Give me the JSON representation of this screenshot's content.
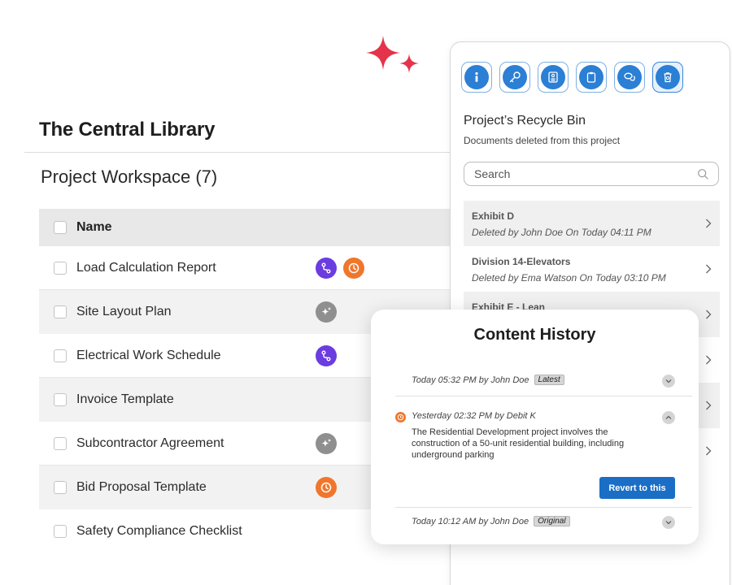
{
  "library": {
    "title": "The Central Library",
    "workspace_title": "Project Workspace (7)",
    "table": {
      "header_label": "Name",
      "rows": [
        {
          "name": "Load Calculation Report",
          "badges": [
            "workflow-icon",
            "history-icon"
          ]
        },
        {
          "name": "Site Layout Plan",
          "badges": [
            "ai-sparkle-icon"
          ]
        },
        {
          "name": "Electrical Work Schedule",
          "badges": [
            "workflow-icon"
          ]
        },
        {
          "name": "Invoice Template",
          "badges": []
        },
        {
          "name": "Subcontractor Agreement",
          "badges": [
            "ai-sparkle-icon"
          ]
        },
        {
          "name": "Bid Proposal Template",
          "badges": [
            "history-icon"
          ]
        },
        {
          "name": "Safety Compliance Checklist",
          "badges": []
        }
      ]
    }
  },
  "side_panel": {
    "toolbar_icons": [
      "info-icon",
      "key-icon",
      "contact-card-icon",
      "clipboard-icon",
      "chat-icon",
      "recycle-bin-icon"
    ],
    "active_icon": "recycle-bin-icon",
    "title": "Project’s Recycle Bin",
    "subtitle": "Documents deleted from this project",
    "search": {
      "placeholder": "Search"
    },
    "deleted_items": [
      {
        "name": "Exhibit D",
        "detail": "Deleted by John Doe On Today 04:11 PM"
      },
      {
        "name": "Division 14-Elevators",
        "detail": "Deleted by Ema Watson On Today 03:10 PM"
      },
      {
        "name": "Exhibit E - Lean",
        "detail": ""
      }
    ]
  },
  "content_history": {
    "title": "Content History",
    "entries": [
      {
        "meta": "Today 05:32 PM by John Doe",
        "tag": "Latest",
        "expanded": false
      },
      {
        "meta": "Yesterday 02:32 PM by Debit K",
        "tag": "",
        "expanded": true,
        "body": "The Residential Development project involves the construction of a 50-unit residential building, including underground parking",
        "action": "Revert to this"
      },
      {
        "meta": "Today 10:12 AM by John Doe",
        "tag": "Original",
        "expanded": false
      }
    ]
  },
  "colors": {
    "accent_blue": "#2b7fd4",
    "sparkle_red": "#e5334b",
    "purple": "#6b3ce0",
    "orange": "#f0762c",
    "revert_button": "#1a6ec6"
  }
}
